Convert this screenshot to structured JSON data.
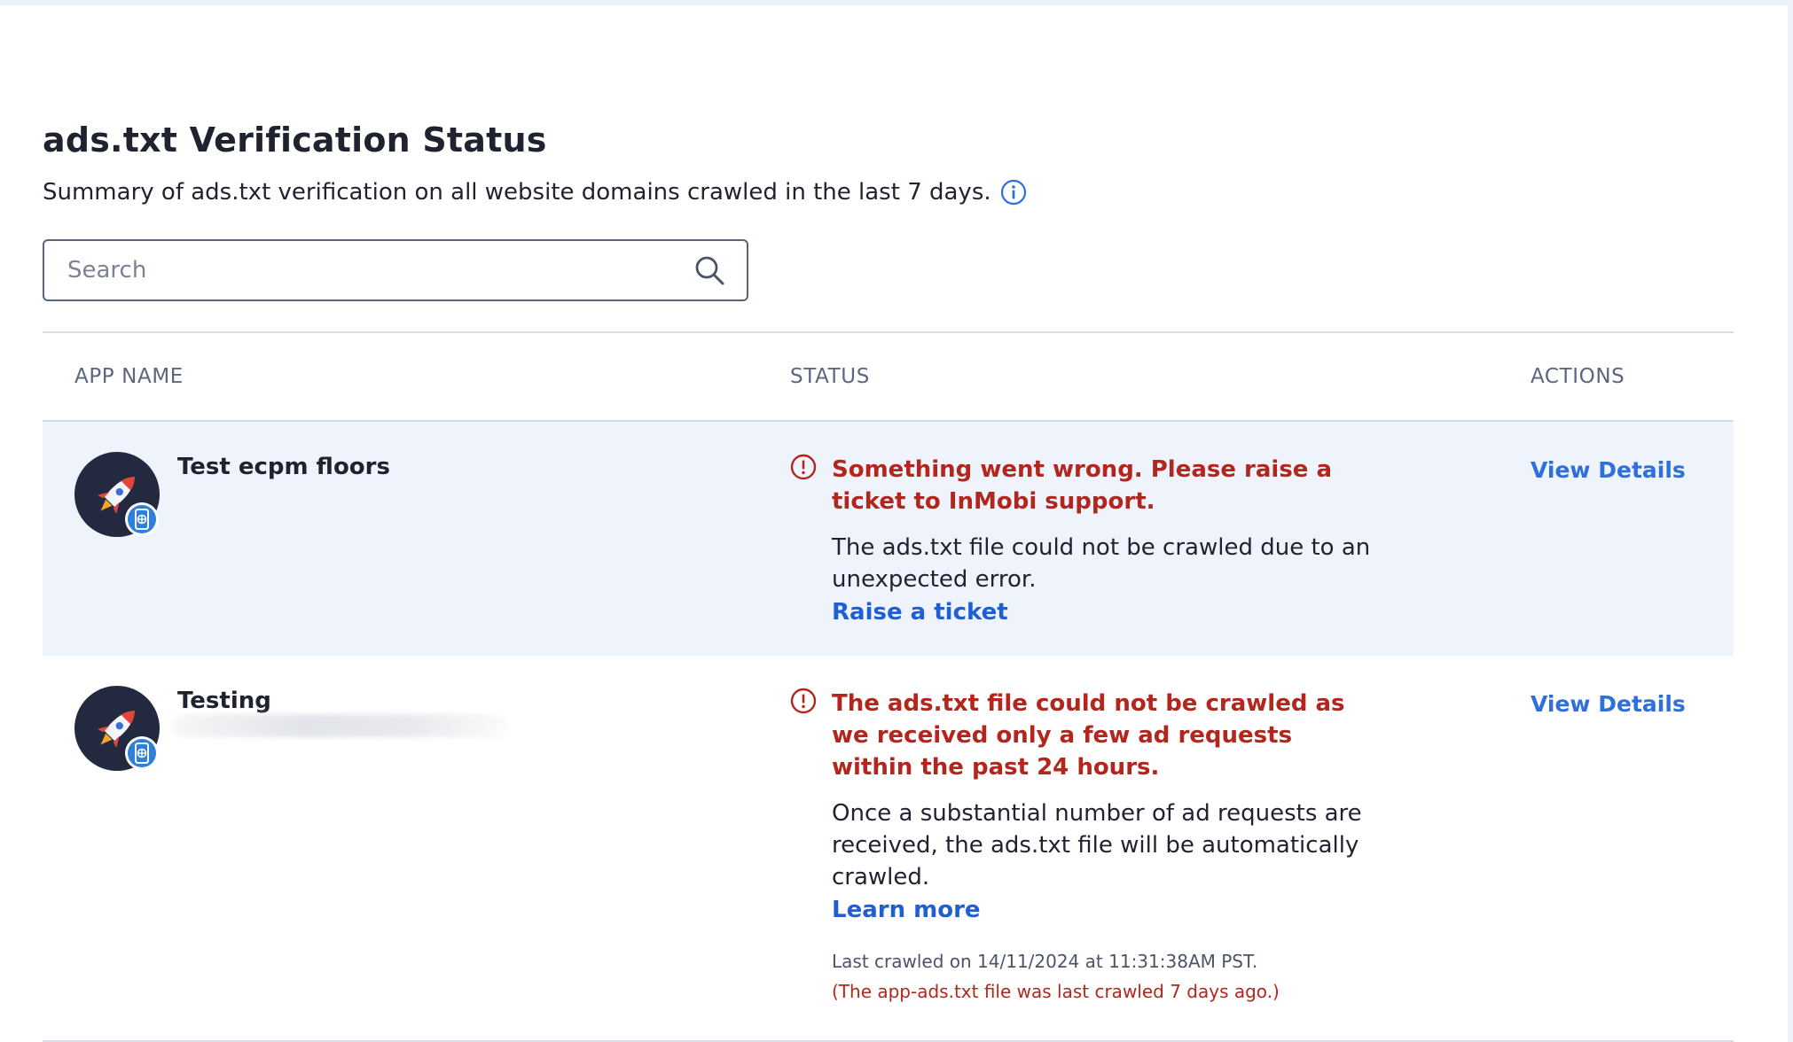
{
  "page": {
    "title": "ads.txt Verification Status",
    "subtitle": "Summary of ads.txt verification on all website domains crawled in the last 7 days."
  },
  "search": {
    "placeholder": "Search",
    "value": ""
  },
  "table": {
    "columns": {
      "app_name": "APP NAME",
      "status": "STATUS",
      "actions": "ACTIONS"
    },
    "rows": [
      {
        "app_name": "Test ecpm floors",
        "status_error": "Something went wrong. Please raise a ticket to InMobi support.",
        "status_description": "The ads.txt file could not be crawled due to an unexpected error.",
        "status_link": "Raise a ticket",
        "action": "View Details"
      },
      {
        "app_name": "Testing",
        "status_error": "The ads.txt file could not be crawled as we received only a few ad requests within the past 24 hours.",
        "status_description": "Once a substantial number of ad requests are received, the ads.txt file will be automatically crawled.",
        "status_link": "Learn more",
        "last_crawled": "Last crawled on 14/11/2024 at 11:31:38AM PST.",
        "last_crawled_note": "(The app-ads.txt file was last crawled 7 days ago.)",
        "action": "View Details"
      }
    ]
  },
  "icons": {
    "info": "info-circle-icon",
    "search": "search-icon",
    "status_error": "exclamation-circle-icon",
    "app_avatar": "rocket-icon",
    "app_platform_badge": "web-platform-icon"
  },
  "colors": {
    "error": "#b3261e",
    "link": "#1f5fd1",
    "action_link": "#2f6fdc",
    "highlight_row": "#eff4fc",
    "avatar_bg": "#232a3f",
    "badge_bg": "#2f7fd8"
  }
}
